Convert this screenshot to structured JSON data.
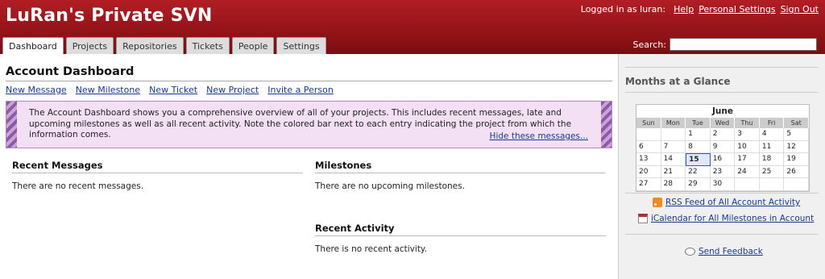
{
  "header": {
    "title": "LuRan's Private SVN",
    "logged_in": "Logged in as luran:",
    "links": [
      "Help",
      "Personal Settings",
      "Sign Out"
    ],
    "search_label": "Search:",
    "search_value": ""
  },
  "tabs": [
    "Dashboard",
    "Projects",
    "Repositories",
    "Tickets",
    "People",
    "Settings"
  ],
  "main": {
    "title": "Account Dashboard",
    "actions": [
      "New Message",
      "New Milestone",
      "New Ticket",
      "New Project",
      "Invite a Person"
    ],
    "notice": "The Account Dashboard shows you a comprehensive overview of all of your projects. This includes recent messages, late and upcoming milestones as well as all recent activity. Note the colored bar next to each entry indicating the project from which the information comes.",
    "notice_hide": "Hide these messages...",
    "messages": {
      "title": "Recent Messages",
      "empty": "There are no recent messages."
    },
    "milestones": {
      "title": "Milestones",
      "empty": "There are no upcoming milestones."
    },
    "activity": {
      "title": "Recent Activity",
      "empty": "There is no recent activity."
    }
  },
  "sidebar": {
    "months_title": "Months at a Glance",
    "calendar": {
      "month": "June",
      "dow": [
        "Sun",
        "Mon",
        "Tue",
        "Wed",
        "Thu",
        "Fri",
        "Sat"
      ],
      "today": "15",
      "cells": [
        "",
        "",
        "1",
        "2",
        "3",
        "4",
        "5",
        "6",
        "7",
        "8",
        "9",
        "10",
        "11",
        "12",
        "13",
        "14",
        "15",
        "16",
        "17",
        "18",
        "19",
        "20",
        "21",
        "22",
        "23",
        "24",
        "25",
        "26",
        "27",
        "28",
        "29",
        "30",
        "",
        "",
        ""
      ]
    },
    "rss_link": "RSS Feed of All Account Activity",
    "ical_link": "iCalendar for All Milestones in Account",
    "feedback_link": "Send Feedback"
  },
  "colors": {
    "header": "#8d1217",
    "notice_bg": "#f3e0f5",
    "notice_stripe": "#8e5aa8",
    "link": "#1a3a8a"
  }
}
